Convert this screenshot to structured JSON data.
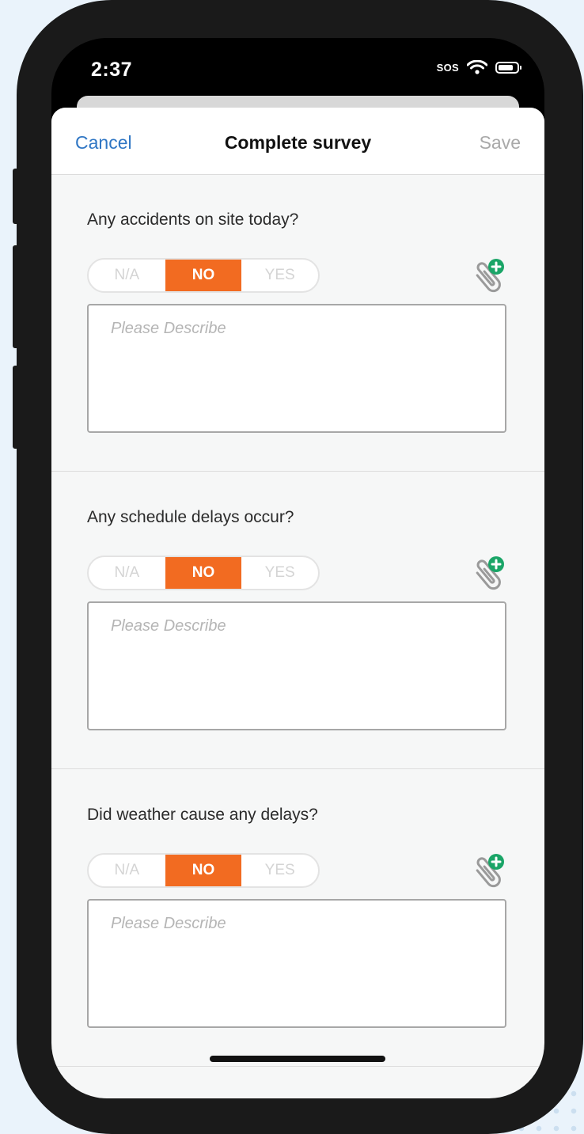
{
  "status_bar": {
    "time": "2:37",
    "carrier": "SOS",
    "icons": [
      "wifi-icon",
      "battery-icon"
    ]
  },
  "nav": {
    "cancel_label": "Cancel",
    "title": "Complete survey",
    "save_label": "Save"
  },
  "colors": {
    "accent_orange": "#f26b21",
    "link_blue": "#2f76c4",
    "attach_green": "#1aa567"
  },
  "questions": [
    {
      "text": "Any accidents on site today?",
      "options": [
        "N/A",
        "NO",
        "YES"
      ],
      "selected": "NO",
      "placeholder": "Please Describe",
      "attachment_icon": "paperclip-add-icon"
    },
    {
      "text": "Any schedule delays occur?",
      "options": [
        "N/A",
        "NO",
        "YES"
      ],
      "selected": "NO",
      "placeholder": "Please Describe",
      "attachment_icon": "paperclip-add-icon"
    },
    {
      "text": "Did weather cause any delays?",
      "options": [
        "N/A",
        "NO",
        "YES"
      ],
      "selected": "NO",
      "placeholder": "Please Describe",
      "attachment_icon": "paperclip-add-icon"
    }
  ]
}
